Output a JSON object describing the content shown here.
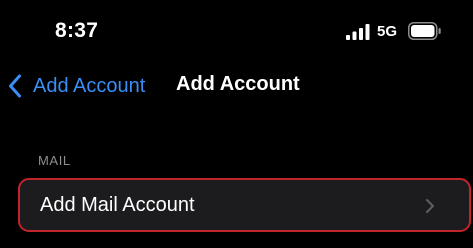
{
  "status_bar": {
    "time": "8:37",
    "network": "5G",
    "signal_icon": "cellular-signal-icon",
    "battery_icon": "battery-icon"
  },
  "nav": {
    "back_label": "Add Account",
    "back_icon": "chevron-left-icon",
    "title": "Add Account"
  },
  "section": {
    "header": "MAIL",
    "rows": [
      {
        "label": "Add Mail Account",
        "icon": "chevron-right-icon"
      }
    ]
  },
  "colors": {
    "background": "#000000",
    "accent": "#3a8ef6",
    "row_background": "#1c1c1e",
    "highlight_border": "#c2242c",
    "secondary_text": "#8e8e93"
  }
}
